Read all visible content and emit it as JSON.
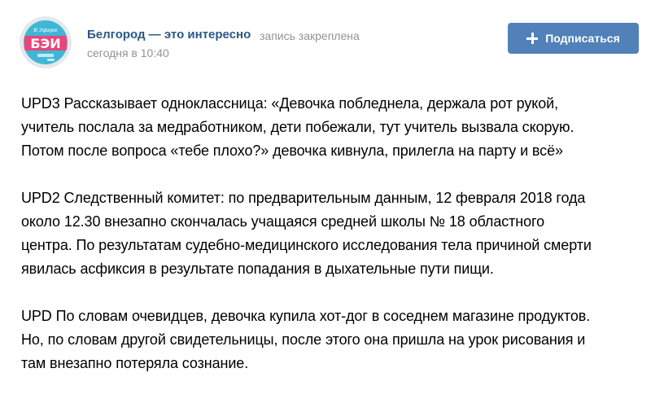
{
  "post": {
    "author": "Белгород — это интересно",
    "pinned_note": "запись закреплена",
    "time": "сегодня в 10:40",
    "avatar": {
      "top_text": "В Эфире",
      "logo": "БЭИ",
      "colors": {
        "ring": "#e5e8ec",
        "inner": "#3fb6d6",
        "band": "#e9467b"
      }
    },
    "subscribe_label": "Подписаться",
    "paragraphs": [
      [
        "UPD3 Рассказывает одноклассница: «Девочка побледнела, держала рот рукой,",
        "учитель послала за медработником, дети побежали, тут учитель вызвала скорую.",
        "Потом после вопроса «тебе плохо?» девочка кивнула, прилегла на парту и всё»"
      ],
      [
        "UPD2 Следственный комитет: по предварительным данным, 12 февраля 2018 года",
        "около 12.30 внезапно скончалась учащаяся средней школы № 18 областного",
        "центра. По результатам судебно-медицинского исследования тела причиной смерти",
        "явилась асфиксия в результате попадания в дыхательные пути пищи."
      ],
      [
        "UPD По словам очевидцев, девочка купила хот-дог в соседнем магазине продуктов.",
        "Но, по словам другой свидетельницы, после этого она пришла на урок рисования и",
        "там внезапно потеряла сознание."
      ]
    ]
  },
  "theme": {
    "accent": "#5181b8",
    "link": "#2a5885",
    "muted": "#939393",
    "text": "#000000"
  }
}
